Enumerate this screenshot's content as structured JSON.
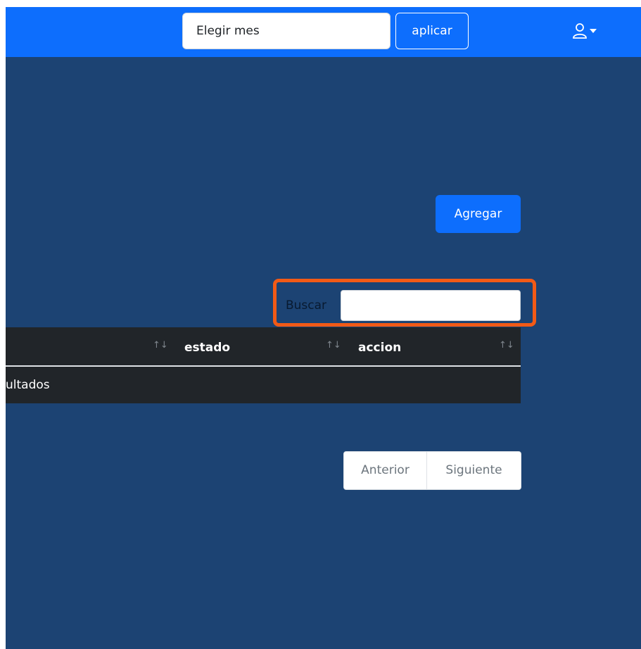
{
  "navbar": {
    "month_value": "Elegir mes",
    "apply_label": "aplicar",
    "user_icon": "user-icon",
    "dropdown_icon": "caret-down-icon"
  },
  "actions": {
    "add_label": "Agregar"
  },
  "search": {
    "label": "Buscar",
    "value": ""
  },
  "table": {
    "columns": [
      {
        "label": ""
      },
      {
        "label": "estado"
      },
      {
        "label": "accion"
      }
    ],
    "sort_icon": "↑↓",
    "empty_message": "ultados"
  },
  "pagination": {
    "previous": "Anterior",
    "next": "Siguiente"
  },
  "colors": {
    "navbar": "#0d6efd",
    "background": "#1c4373",
    "table": "#212529",
    "highlight": "#f25a16"
  }
}
